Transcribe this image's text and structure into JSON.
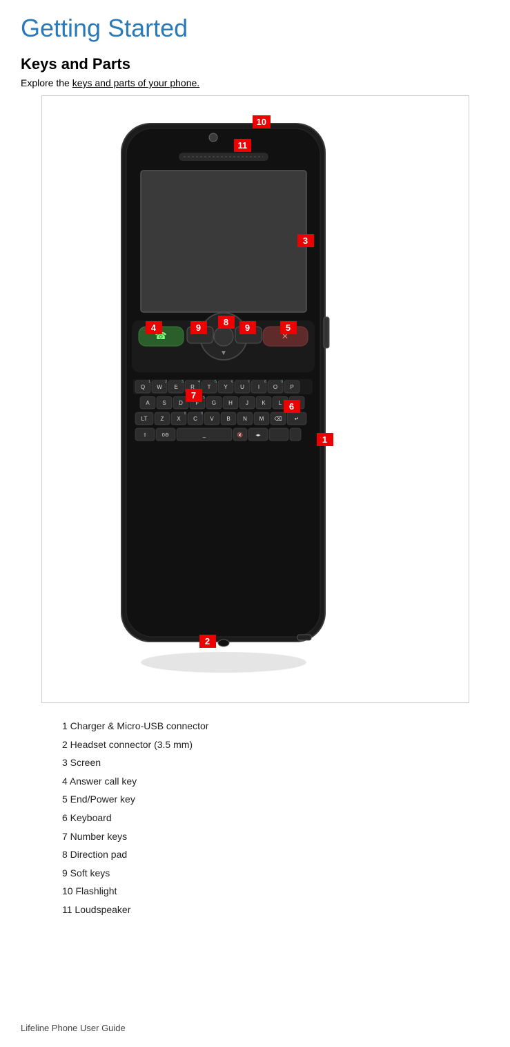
{
  "page": {
    "title": "Getting Started",
    "section_title": "Keys and Parts",
    "intro": "Explore the keys and parts of your phone.",
    "footer": "Lifeline Phone User Guide"
  },
  "badges": [
    {
      "id": "badge-1",
      "label": "1",
      "description": "Charger & Micro-USB connector"
    },
    {
      "id": "badge-2",
      "label": "2",
      "description": "Headset connector (3.5 mm)"
    },
    {
      "id": "badge-3",
      "label": "3",
      "description": "Screen"
    },
    {
      "id": "badge-4",
      "label": "4",
      "description": "Answer call key"
    },
    {
      "id": "badge-5",
      "label": "5",
      "description": "End/Power key"
    },
    {
      "id": "badge-6",
      "label": "6",
      "description": "Keyboard"
    },
    {
      "id": "badge-7",
      "label": "7",
      "description": "Number keys"
    },
    {
      "id": "badge-8",
      "label": "8",
      "description": "Direction pad"
    },
    {
      "id": "badge-9a",
      "label": "9",
      "description": "Soft keys (left)"
    },
    {
      "id": "badge-9b",
      "label": "9",
      "description": "Soft keys (right)"
    },
    {
      "id": "badge-10",
      "label": "10",
      "description": "Flashlight"
    },
    {
      "id": "badge-11",
      "label": "11",
      "description": "Loudspeaker"
    }
  ],
  "parts_list": [
    "1 Charger & Micro-USB connector",
    "2 Headset connector (3.5 mm)",
    "3 Screen",
    "4 Answer call key",
    "5 End/Power key",
    "6 Keyboard",
    "7 Number keys",
    "8 Direction pad",
    "9 Soft keys",
    "10 Flashlight",
    "11 Loudspeaker"
  ],
  "keyboard": {
    "rows": [
      [
        "Q",
        "W",
        "E",
        "R",
        "T",
        "Y",
        "U",
        "I",
        "O",
        "P"
      ],
      [
        "A",
        "S",
        "D",
        "F",
        "G",
        "H",
        "J",
        "K",
        "L"
      ],
      [
        "Z",
        "X",
        "C",
        "V",
        "B",
        "N",
        "M",
        "↵"
      ]
    ],
    "numbers": [
      "1",
      "2",
      "3",
      "4",
      "5",
      "6",
      "7",
      "8",
      "9",
      "0"
    ]
  }
}
